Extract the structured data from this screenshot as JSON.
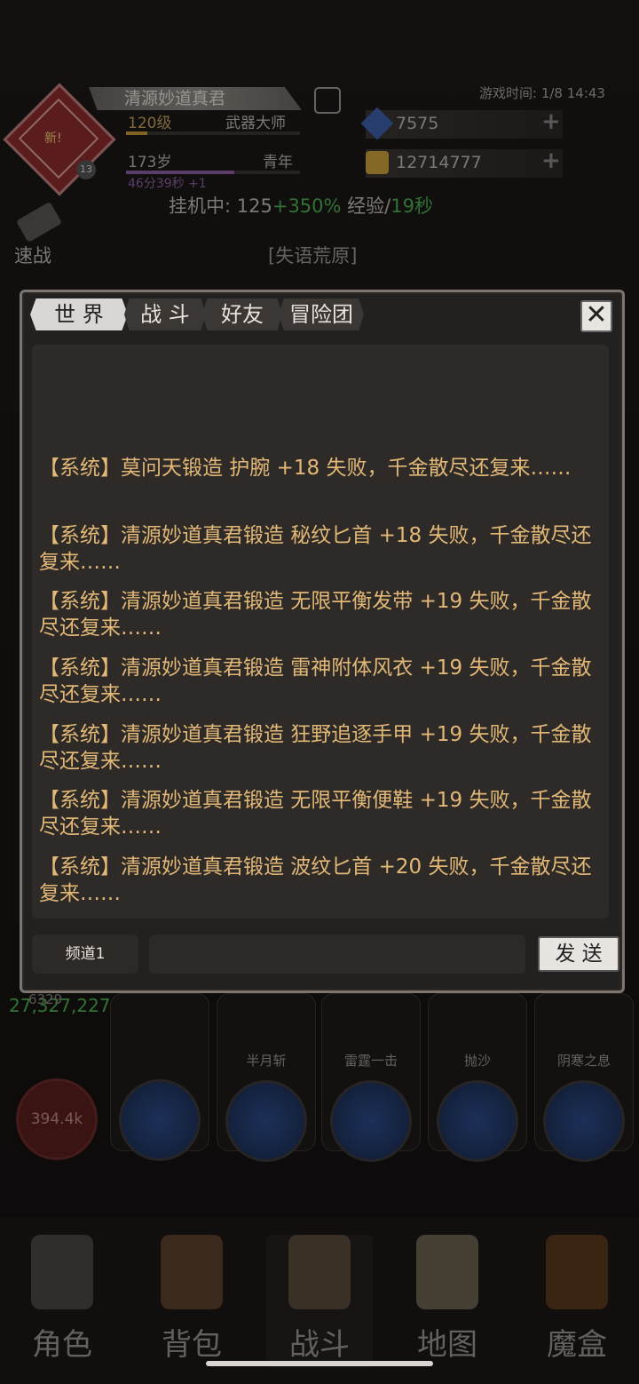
{
  "header": {
    "new_tag": "新!",
    "level_badge": "13",
    "char_name": "清源妙道真君",
    "level": "120级",
    "class_title": "武器大师",
    "age": "173岁",
    "age_stage": "青年",
    "age_timer": "46分39秒 +1",
    "game_time": "游戏时间: 1/8 14:43",
    "gems": "7575",
    "gold": "12714777",
    "idle_prefix": "挂机中: 125",
    "idle_bonus": "+350%",
    "idle_exp": " 经验/",
    "idle_rate": "19秒",
    "speed_battle": "速战",
    "region": "[失语荒原]"
  },
  "skills": {
    "dps_green": "27,327,227",
    "dps_small": "6329",
    "hp": "394.4k",
    "names": [
      "半月斩",
      "雷霆一击",
      "抛沙",
      "阴寒之息"
    ]
  },
  "nav": {
    "items": [
      "角色",
      "背包",
      "战斗",
      "地图",
      "魔盒"
    ]
  },
  "chat": {
    "tabs": [
      "世 界",
      "战 斗",
      "好友",
      "冒险团"
    ],
    "close": "✕",
    "messages": [
      "【系统】莫问天锻造 护腕 +18 失败，千金散尽还复来……",
      "【系统】清源妙道真君锻造 秘纹匕首 +18 失败，千金散尽还复来……",
      "【系统】清源妙道真君锻造 无限平衡发带 +19 失败，千金散尽还复来……",
      "【系统】清源妙道真君锻造 雷神附体风衣 +19 失败，千金散尽还复来……",
      "【系统】清源妙道真君锻造 狂野追逐手甲 +19 失败，千金散尽还复来……",
      "【系统】清源妙道真君锻造 无限平衡便鞋 +19 失败，千金散尽还复来……",
      "【系统】清源妙道真君锻造 波纹匕首 +20 失败，千金散尽还复来……"
    ],
    "channel": "频道1",
    "input_value": "",
    "send": "发 送"
  },
  "colors": {
    "message": "#e2b877",
    "bonus_green": "#4caf50",
    "panel_bg": "#232120"
  }
}
